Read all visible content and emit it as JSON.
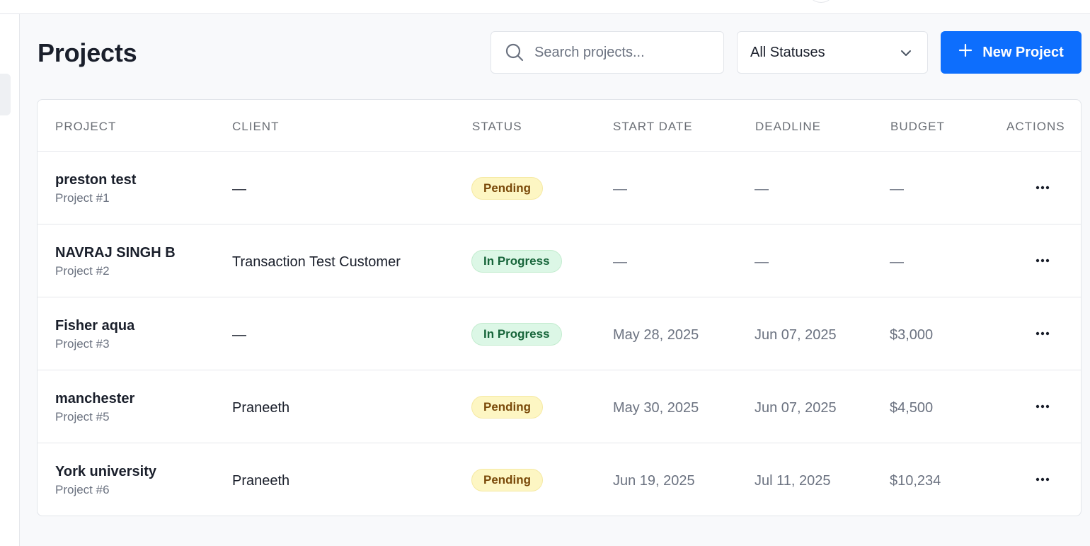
{
  "header": {
    "title": "Projects"
  },
  "search": {
    "placeholder": "Search projects..."
  },
  "status_filter": {
    "selected": "All Statuses"
  },
  "new_project_button": {
    "label": "New Project"
  },
  "colors": {
    "primary": "#0d6efd",
    "pending_bg": "#fdf6c3",
    "pending_text": "#7a4a0a",
    "progress_bg": "#dcf7e6",
    "progress_text": "#17653a"
  },
  "table": {
    "columns": [
      "PROJECT",
      "CLIENT",
      "STATUS",
      "START DATE",
      "DEADLINE",
      "BUDGET",
      "ACTIONS"
    ],
    "rows": [
      {
        "name": "preston test",
        "number": "Project #1",
        "client": "—",
        "status": "Pending",
        "status_type": "pending",
        "start_date": "—",
        "deadline": "—",
        "budget": "—"
      },
      {
        "name": "NAVRAJ SINGH B",
        "number": "Project #2",
        "client": "Transaction Test Customer",
        "status": "In Progress",
        "status_type": "progress",
        "start_date": "—",
        "deadline": "—",
        "budget": "—"
      },
      {
        "name": "Fisher aqua",
        "number": "Project #3",
        "client": "—",
        "status": "In Progress",
        "status_type": "progress",
        "start_date": "May 28, 2025",
        "deadline": "Jun 07, 2025",
        "budget": "$3,000"
      },
      {
        "name": "manchester",
        "number": "Project #5",
        "client": "Praneeth",
        "status": "Pending",
        "status_type": "pending",
        "start_date": "May 30, 2025",
        "deadline": "Jun 07, 2025",
        "budget": "$4,500"
      },
      {
        "name": "York university",
        "number": "Project #6",
        "client": "Praneeth",
        "status": "Pending",
        "status_type": "pending",
        "start_date": "Jun 19, 2025",
        "deadline": "Jul 11, 2025",
        "budget": "$10,234"
      }
    ]
  }
}
